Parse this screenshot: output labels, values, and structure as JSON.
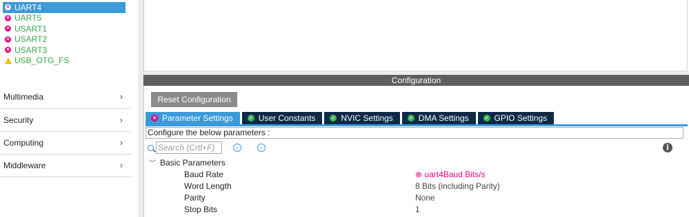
{
  "peripherals": [
    {
      "label": "UART4",
      "status": "error",
      "selected": true
    },
    {
      "label": "UART5",
      "status": "error"
    },
    {
      "label": "USART1",
      "status": "error"
    },
    {
      "label": "USART2",
      "status": "error"
    },
    {
      "label": "USART3",
      "status": "error"
    },
    {
      "label": "USB_OTG_FS",
      "status": "warning"
    }
  ],
  "categories": [
    {
      "label": "Multimedia"
    },
    {
      "label": "Security"
    },
    {
      "label": "Computing"
    },
    {
      "label": "Middleware"
    }
  ],
  "config": {
    "title": "Configuration",
    "reset_label": "Reset Configuration",
    "tabs": [
      {
        "label": "Parameter Settings",
        "icon": "error-icon",
        "active": true
      },
      {
        "label": "User Constants",
        "icon": "check-icon"
      },
      {
        "label": "NVIC Settings",
        "icon": "check-icon"
      },
      {
        "label": "DMA Settings",
        "icon": "check-icon"
      },
      {
        "label": "GPIO Settings",
        "icon": "check-icon"
      }
    ],
    "configure_text": "Configure the below parameters :",
    "search_placeholder": "Search (Crtl+F)",
    "group_label": "Basic Parameters",
    "params": [
      {
        "name": "Baud Rate",
        "value": "uart4Baud Bits/s",
        "error": true
      },
      {
        "name": "Word Length",
        "value": "8 Bits (including Parity)"
      },
      {
        "name": "Parity",
        "value": "None"
      },
      {
        "name": "Stop Bits",
        "value": "1"
      }
    ]
  },
  "colors": {
    "accent": "#3c9ad9",
    "tab_dark": "#0f2a47",
    "error": "#e6007e",
    "ok": "#3cb54a",
    "periph_text": "#3aa54a"
  }
}
